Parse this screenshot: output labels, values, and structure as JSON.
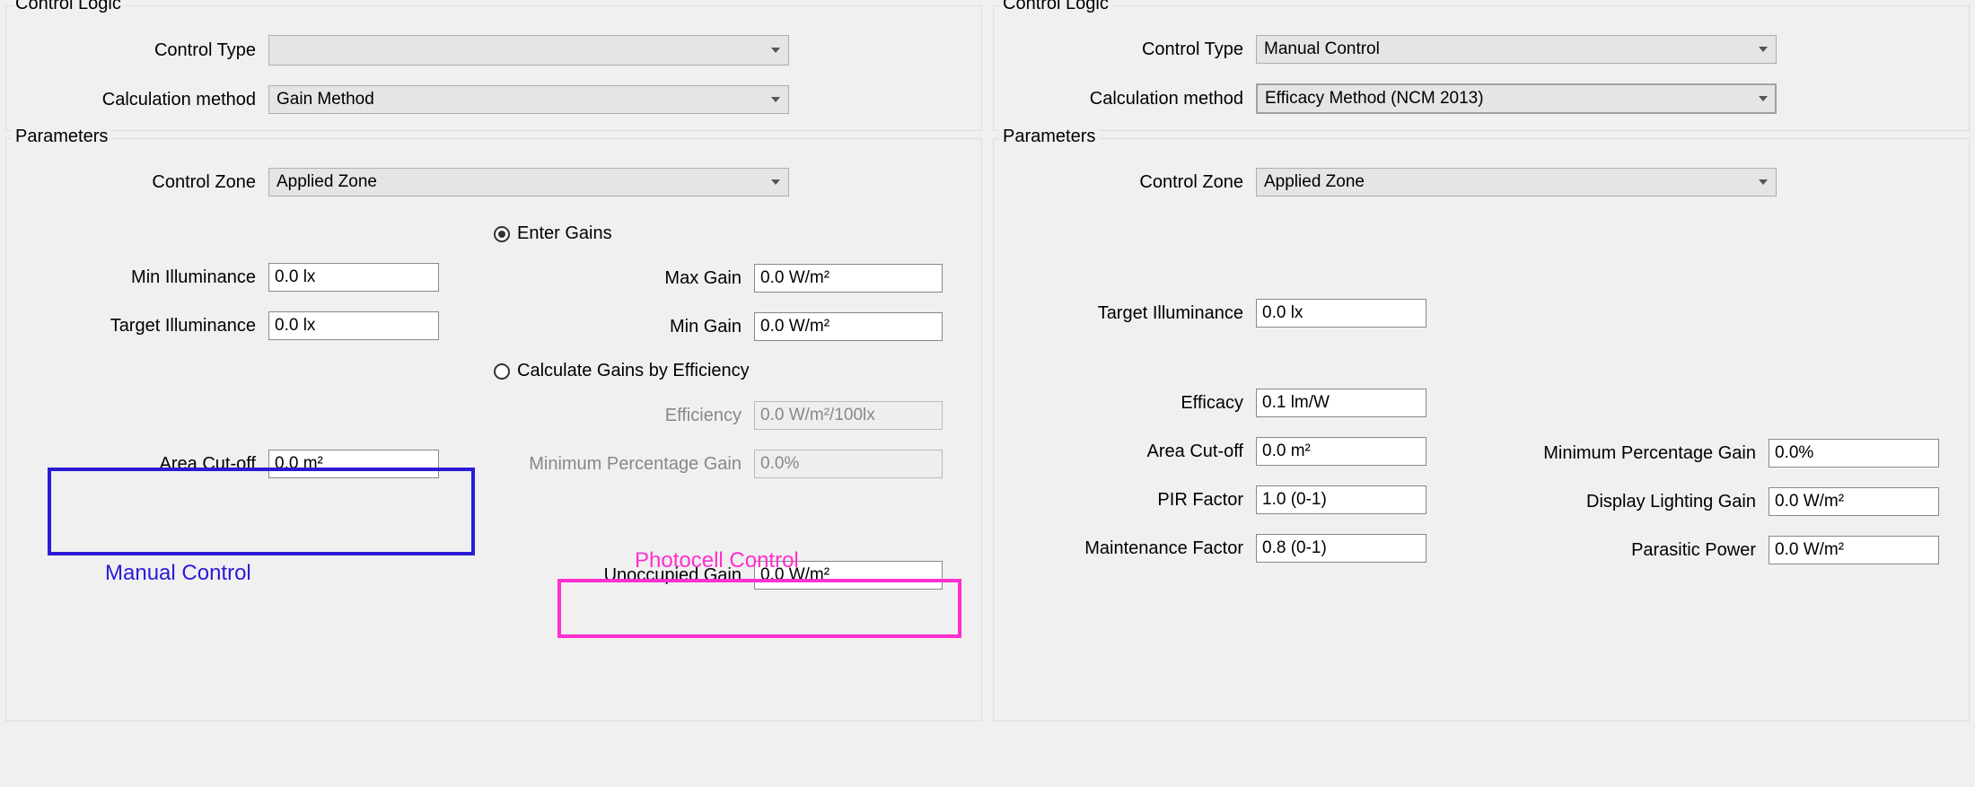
{
  "left": {
    "control_logic": {
      "title": "Control Logic",
      "control_type_label": "Control Type",
      "control_type_value": "",
      "calc_method_label": "Calculation method",
      "calc_method_value": "Gain Method"
    },
    "parameters": {
      "title": "Parameters",
      "control_zone_label": "Control Zone",
      "control_zone_value": "Applied Zone",
      "radio_enter_gains": "Enter Gains",
      "radio_calc_eff": "Calculate Gains by Efficiency",
      "min_illum_label": "Min Illuminance",
      "min_illum_value": "0.0 lx",
      "target_illum_label": "Target Illuminance",
      "target_illum_value": "0.0 lx",
      "max_gain_label": "Max Gain",
      "max_gain_value": "0.0 W/m²",
      "min_gain_label": "Min Gain",
      "min_gain_value": "0.0 W/m²",
      "efficiency_label": "Efficiency",
      "efficiency_value": "0.0 W/m²/100lx",
      "min_pct_gain_label": "Minimum Percentage Gain",
      "min_pct_gain_value": "0.0%",
      "area_cutoff_label": "Area Cut-off",
      "area_cutoff_value": "0.0 m²",
      "unocc_gain_label": "Unoccupied Gain",
      "unocc_gain_value": "0.0 W/m²"
    },
    "annotations": {
      "manual_control": "Manual Control",
      "photocell_control": "Photocell Control"
    }
  },
  "right": {
    "control_logic": {
      "title": "Control Logic",
      "control_type_label": "Control Type",
      "control_type_value": "Manual Control",
      "calc_method_label": "Calculation method",
      "calc_method_value": "Efficacy Method (NCM 2013)"
    },
    "parameters": {
      "title": "Parameters",
      "control_zone_label": "Control Zone",
      "control_zone_value": "Applied Zone",
      "target_illum_label": "Target Illuminance",
      "target_illum_value": "0.0 lx",
      "efficacy_label": "Efficacy",
      "efficacy_value": "0.1 lm/W",
      "area_cutoff_label": "Area Cut-off",
      "area_cutoff_value": "0.0 m²",
      "min_pct_gain_label": "Minimum Percentage Gain",
      "min_pct_gain_value": "0.0%",
      "pir_label": "PIR Factor",
      "pir_value": "1.0 (0-1)",
      "display_light_label": "Display Lighting Gain",
      "display_light_value": "0.0 W/m²",
      "maint_label": "Maintenance Factor",
      "maint_value": "0.8 (0-1)",
      "parasitic_label": "Parasitic Power",
      "parasitic_value": "0.0 W/m²"
    }
  }
}
